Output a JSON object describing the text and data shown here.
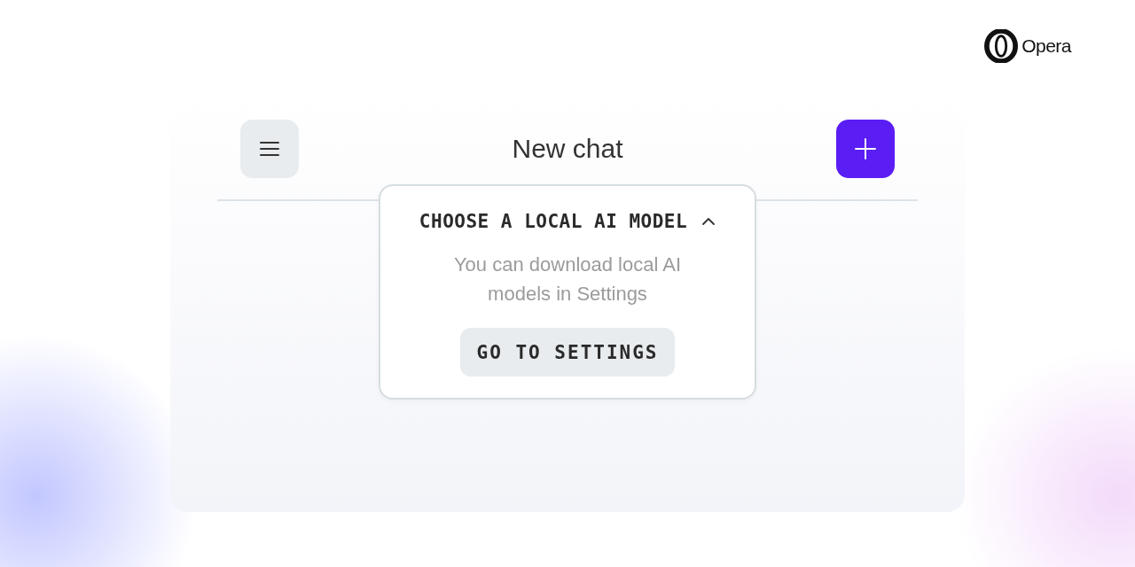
{
  "brand": {
    "name": "Opera"
  },
  "header": {
    "title": "New chat"
  },
  "model_menu": {
    "title": "CHOOSE A LOCAL AI MODEL",
    "expanded": true,
    "message": "You can download local AI models in Settings",
    "button": "GO TO SETTINGS"
  }
}
